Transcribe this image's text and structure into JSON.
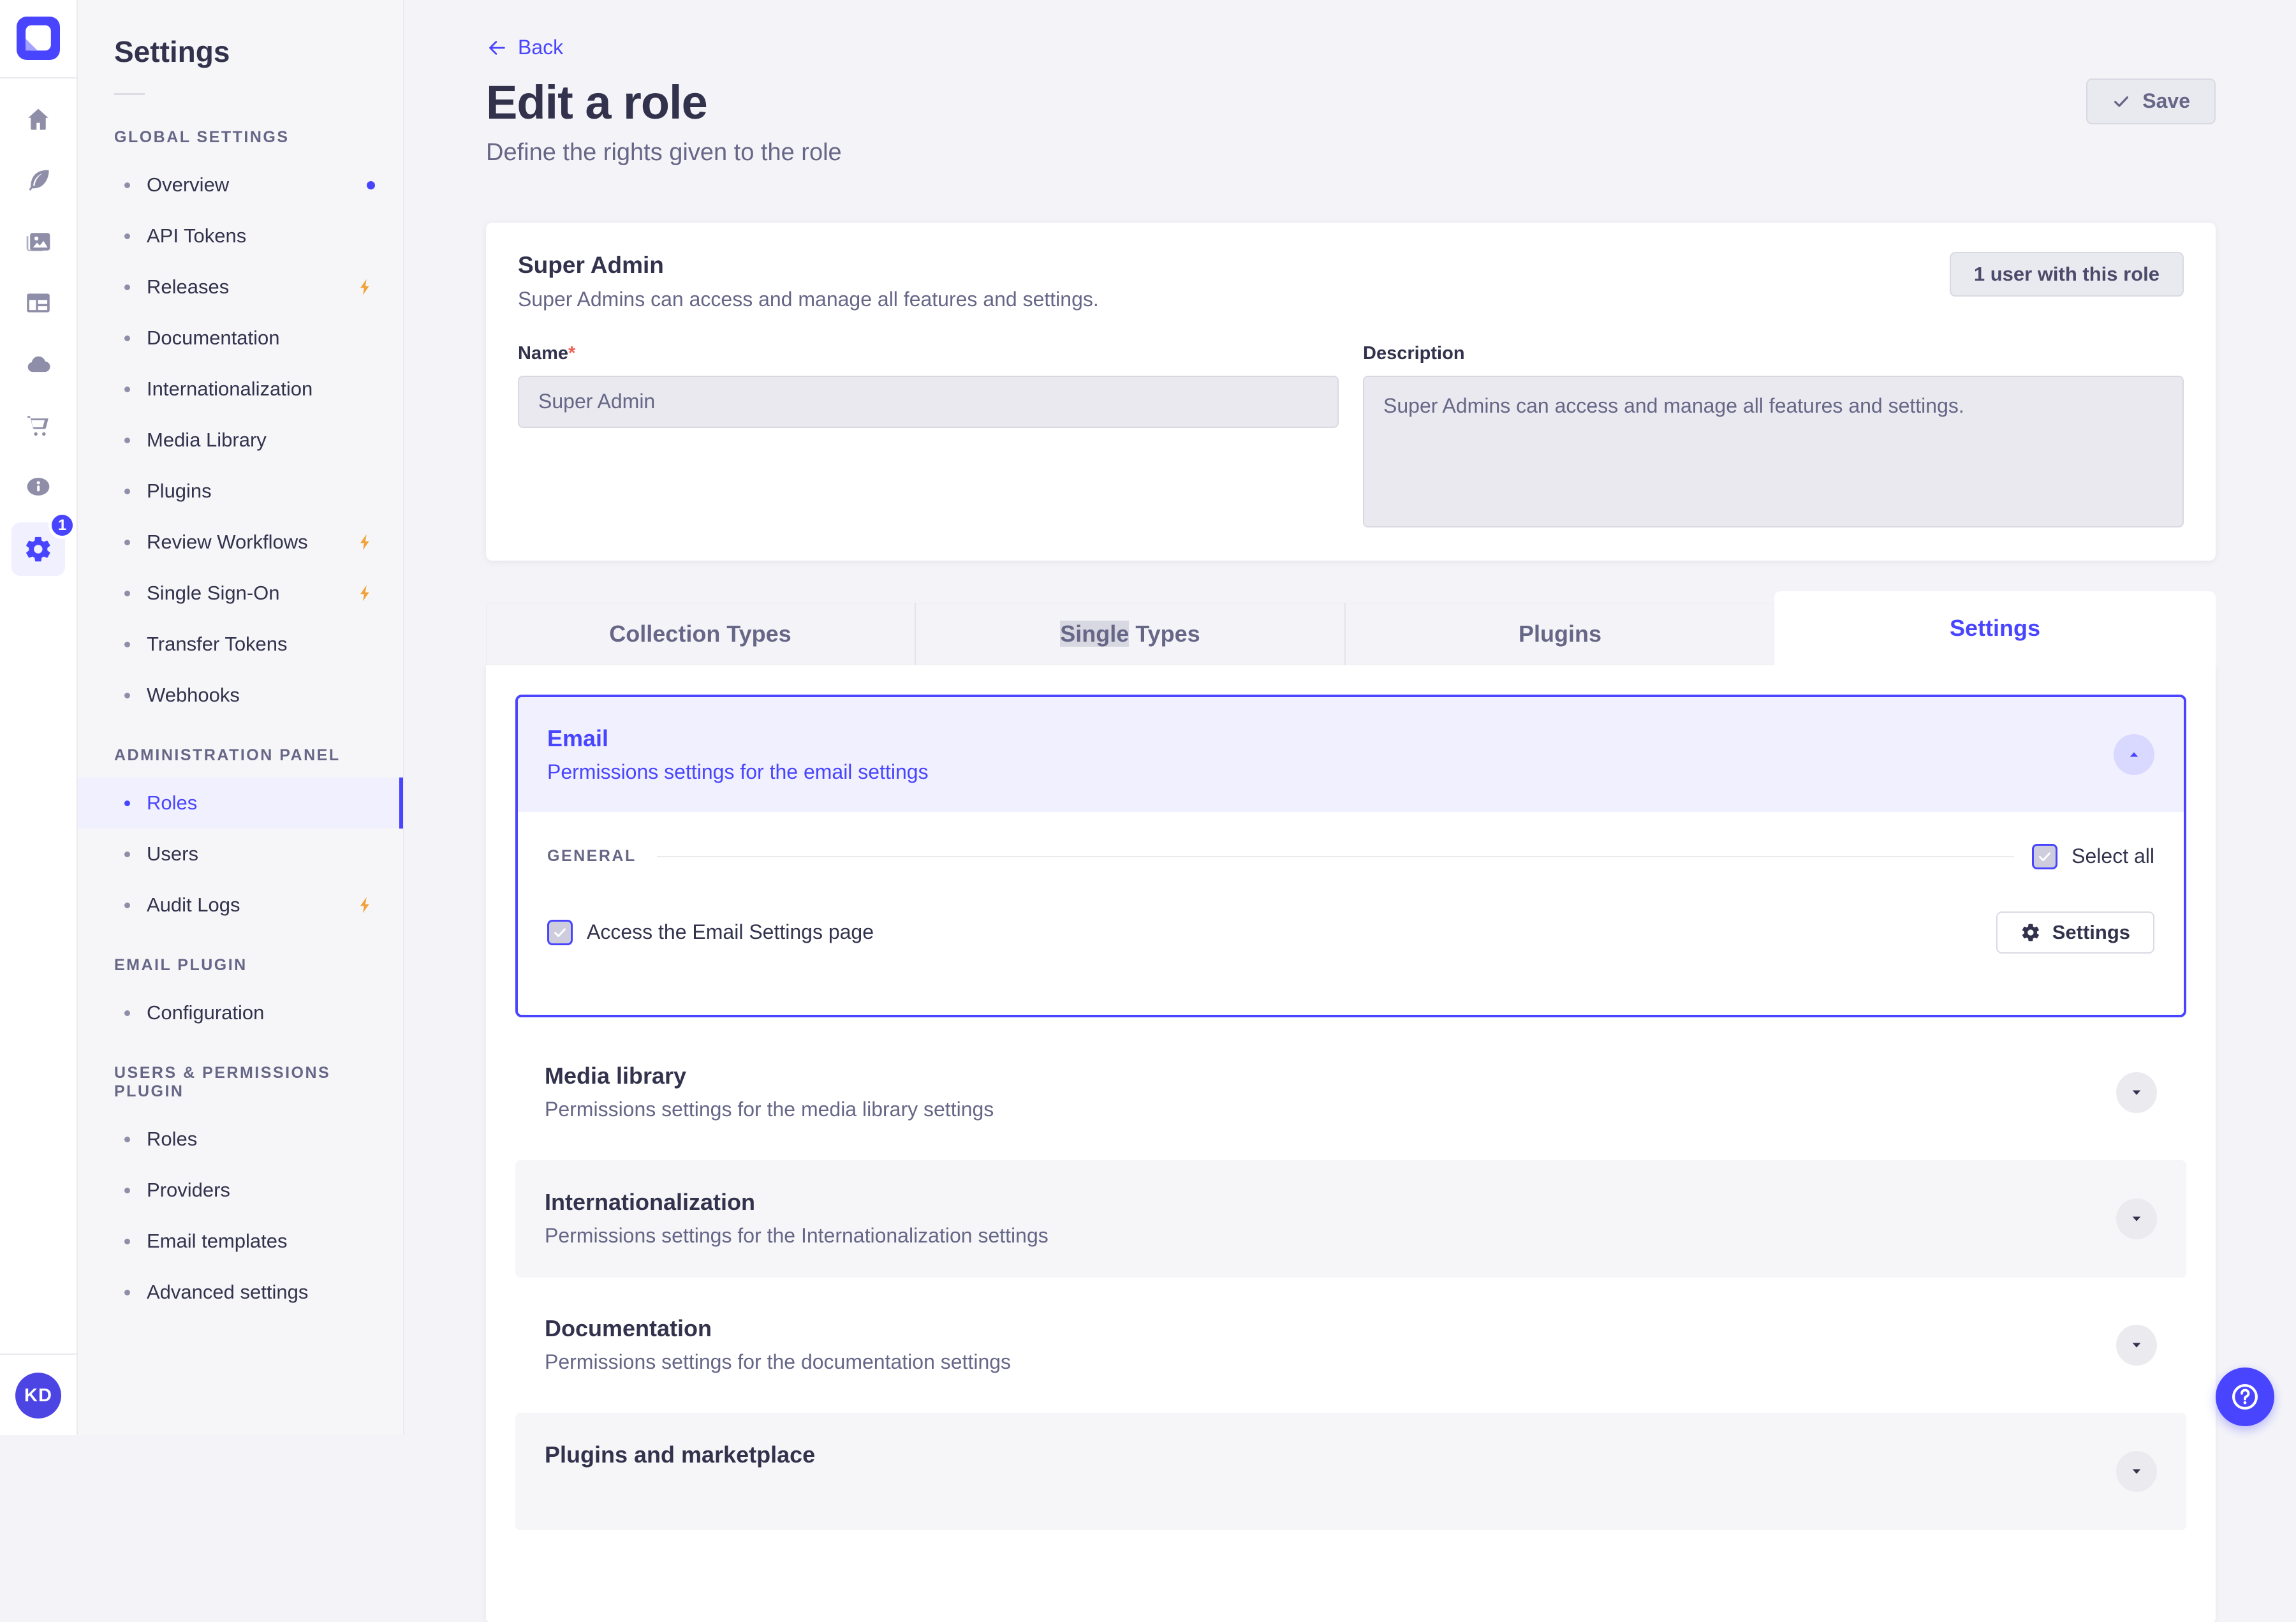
{
  "colors": {
    "accent": "#4945FF",
    "accent_soft": "#F0F0FF",
    "accent_chip": "#D9D8FF",
    "text_dark": "#32324D",
    "text_gray": "#666687",
    "icon_gray": "#8E8EA9",
    "border": "#DCDCE4",
    "divider": "#EAEAEF",
    "shaded": "#F6F6F9",
    "bolt": "#F0A33C",
    "danger": "#EE5E52"
  },
  "rail": {
    "icons": [
      "home",
      "content-type-builder",
      "media-library",
      "content-manager",
      "deploy-cloud",
      "marketplace",
      "information",
      "settings"
    ],
    "settings_badge": "1",
    "avatar_initials": "KD"
  },
  "sidebar": {
    "title": "Settings",
    "sections": [
      {
        "label": "GLOBAL SETTINGS",
        "items": [
          {
            "label": "Overview",
            "dot": true
          },
          {
            "label": "API Tokens"
          },
          {
            "label": "Releases",
            "lightning": true
          },
          {
            "label": "Documentation"
          },
          {
            "label": "Internationalization"
          },
          {
            "label": "Media Library"
          },
          {
            "label": "Plugins"
          },
          {
            "label": "Review Workflows",
            "lightning": true
          },
          {
            "label": "Single Sign-On",
            "lightning": true
          },
          {
            "label": "Transfer Tokens"
          },
          {
            "label": "Webhooks"
          }
        ]
      },
      {
        "label": "ADMINISTRATION PANEL",
        "items": [
          {
            "label": "Roles",
            "active": true
          },
          {
            "label": "Users"
          },
          {
            "label": "Audit Logs",
            "lightning": true
          }
        ]
      },
      {
        "label": "EMAIL PLUGIN",
        "items": [
          {
            "label": "Configuration"
          }
        ]
      },
      {
        "label": "USERS & PERMISSIONS PLUGIN",
        "items": [
          {
            "label": "Roles"
          },
          {
            "label": "Providers"
          },
          {
            "label": "Email templates"
          },
          {
            "label": "Advanced settings"
          }
        ]
      }
    ]
  },
  "header": {
    "back_label": "Back",
    "title": "Edit a role",
    "subtitle": "Define the rights given to the role",
    "save_label": "Save"
  },
  "role_card": {
    "title": "Super Admin",
    "subtitle": "Super Admins can access and manage all features and settings.",
    "users_button_label": "1 user with this role",
    "name_label": "Name",
    "name_required_mark": "*",
    "name_value": "Super Admin",
    "description_label": "Description",
    "description_value": "Super Admins can access and manage all features and settings."
  },
  "tabs": {
    "items": [
      {
        "label": "Collection Types"
      },
      {
        "label_highlight": "Single",
        "label_rest": " Types"
      },
      {
        "label": "Plugins"
      },
      {
        "label": "Settings",
        "active": true
      }
    ]
  },
  "permissions": {
    "email": {
      "title": "Email",
      "subtitle": "Permissions settings for the email settings",
      "general_label": "GENERAL",
      "select_all_label": "Select all",
      "select_all_checked": true,
      "access_label": "Access the Email Settings page",
      "access_checked": true,
      "settings_button_label": "Settings"
    },
    "rows": [
      {
        "title": "Media library",
        "subtitle": "Permissions settings for the media library settings"
      },
      {
        "title": "Internationalization",
        "subtitle": "Permissions settings for the Internationalization settings",
        "shaded": true
      },
      {
        "title": "Documentation",
        "subtitle": "Permissions settings for the documentation settings"
      },
      {
        "title": "Plugins and marketplace",
        "shaded": true
      }
    ]
  }
}
